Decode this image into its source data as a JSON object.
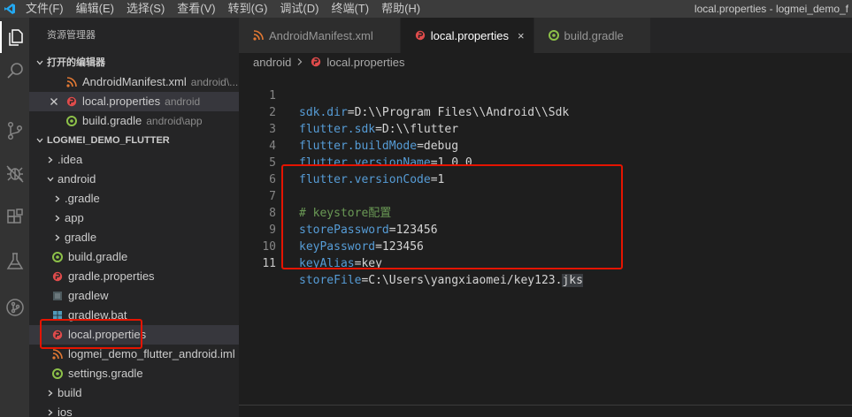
{
  "menubar": {
    "items": [
      "文件(F)",
      "编辑(E)",
      "选择(S)",
      "查看(V)",
      "转到(G)",
      "调试(D)",
      "终端(T)",
      "帮助(H)"
    ],
    "window_title": "local.properties - logmei_demo_f"
  },
  "activity": [
    "explorer-icon",
    "search-icon",
    "source-control-icon",
    "debug-icon",
    "extensions-icon",
    "flask-icon",
    "git-graph-icon"
  ],
  "sidebar": {
    "title": "资源管理器",
    "open_editors": {
      "header": "打开的编辑器",
      "items": [
        {
          "label": "AndroidManifest.xml",
          "desc": "android\\...",
          "icon": "rss-icon"
        },
        {
          "label": "local.properties",
          "desc": "android",
          "icon": "properties-icon"
        },
        {
          "label": "build.gradle",
          "desc": "android\\app",
          "icon": "gradle-icon"
        }
      ]
    },
    "project": {
      "header": "LOGMEI_DEMO_FLUTTER",
      "items": [
        {
          "label": ".idea"
        },
        {
          "label": "android"
        },
        {
          "label": ".gradle"
        },
        {
          "label": "app"
        },
        {
          "label": "gradle"
        },
        {
          "label": "build.gradle"
        },
        {
          "label": "gradle.properties"
        },
        {
          "label": "gradlew"
        },
        {
          "label": "gradlew.bat"
        },
        {
          "label": "local.properties"
        },
        {
          "label": "logmei_demo_flutter_android.iml"
        },
        {
          "label": "settings.gradle"
        },
        {
          "label": "build"
        },
        {
          "label": "ios"
        }
      ]
    }
  },
  "tabs": [
    {
      "label": "AndroidManifest.xml"
    },
    {
      "label": "local.properties",
      "close": "×"
    },
    {
      "label": "build.gradle"
    }
  ],
  "breadcrumb": [
    "android",
    "local.properties"
  ],
  "editor": {
    "lines": [
      {
        "n": "1",
        "key": "sdk.dir",
        "eq": "=",
        "val": "D:\\\\Program Files\\\\Android\\\\Sdk"
      },
      {
        "n": "2",
        "key": "flutter.sdk",
        "eq": "=",
        "val": "D:\\\\flutter"
      },
      {
        "n": "3",
        "key": "flutter.buildMode",
        "eq": "=",
        "val": "debug"
      },
      {
        "n": "4",
        "key": "flutter.versionName",
        "eq": "=",
        "val": "1.0.0"
      },
      {
        "n": "5",
        "key": "flutter.versionCode",
        "eq": "=",
        "val": "1"
      },
      {
        "n": "6",
        "key": "",
        "eq": "",
        "val": ""
      },
      {
        "n": "7",
        "comment": "# keystore配置"
      },
      {
        "n": "8",
        "key": "storePassword",
        "eq": "=",
        "val": "123456"
      },
      {
        "n": "9",
        "key": "keyPassword",
        "eq": "=",
        "val": "123456"
      },
      {
        "n": "10",
        "key": "keyAlias",
        "eq": "=",
        "val": "key"
      },
      {
        "n": "11",
        "key": "storeFile",
        "eq": "=",
        "val": "C:\\Users\\yangxiaomei/key123.",
        "val_hl": "jks"
      }
    ]
  },
  "colors": {
    "annotation_box": "#e51400",
    "properties_icon": "#e04b4b",
    "gradle_icon": "#8dc149",
    "rss_icon": "#e37933"
  }
}
